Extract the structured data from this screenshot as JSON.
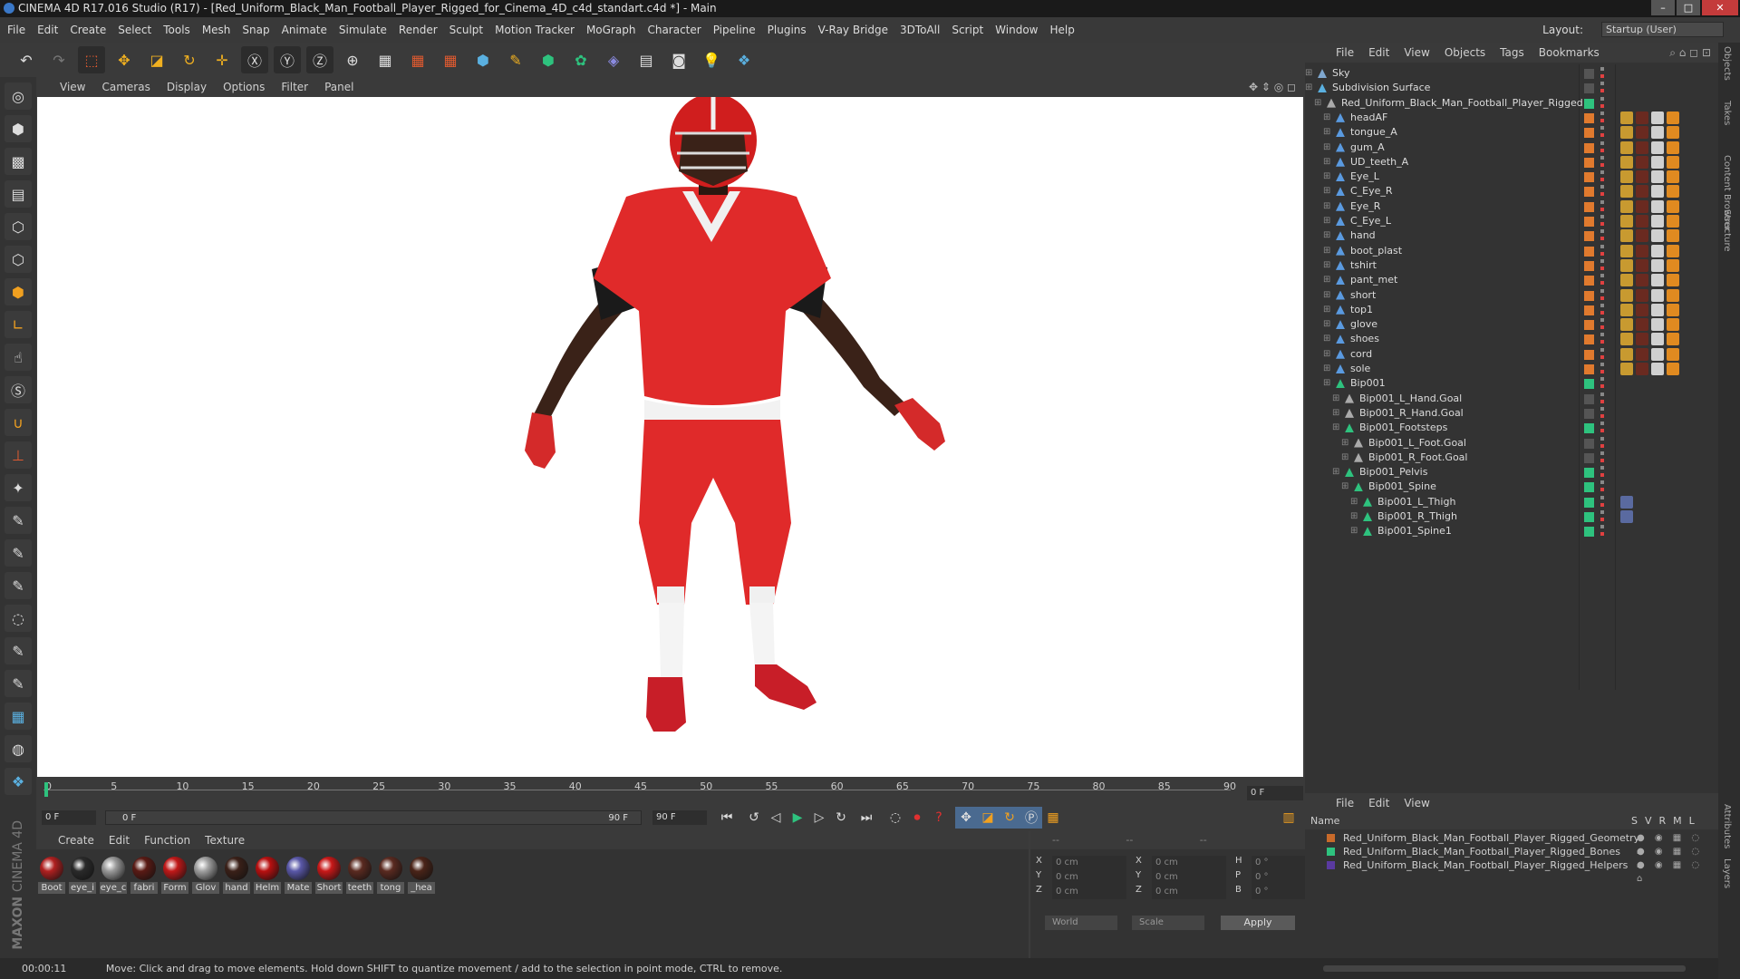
{
  "window": {
    "title": "CINEMA 4D R17.016 Studio (R17) - [Red_Uniform_Black_Man_Football_Player_Rigged_for_Cinema_4D_c4d_standart.c4d *] - Main"
  },
  "menu": [
    "File",
    "Edit",
    "Create",
    "Select",
    "Tools",
    "Mesh",
    "Snap",
    "Animate",
    "Simulate",
    "Render",
    "Sculpt",
    "Motion Tracker",
    "MoGraph",
    "Character",
    "Pipeline",
    "Plugins",
    "V-Ray Bridge",
    "3DToAll",
    "Script",
    "Window",
    "Help"
  ],
  "layout": {
    "label": "Layout:",
    "value": "Startup (User)"
  },
  "viewport_menu": [
    "View",
    "Cameras",
    "Display",
    "Options",
    "Filter",
    "Panel"
  ],
  "timeline": {
    "ticks": [
      "0",
      "5",
      "10",
      "15",
      "20",
      "25",
      "30",
      "35",
      "40",
      "45",
      "50",
      "55",
      "60",
      "65",
      "70",
      "75",
      "80",
      "85",
      "90"
    ],
    "current": "0 F"
  },
  "playbar": {
    "start": "0 F",
    "slider_start": "0 F",
    "slider_end": "90 F",
    "end": "90 F"
  },
  "material_menu": [
    "Create",
    "Edit",
    "Function",
    "Texture"
  ],
  "materials": [
    {
      "name": "Boot",
      "color": "#b02020"
    },
    {
      "name": "eye_i",
      "color": "#2a2a2a"
    },
    {
      "name": "eye_c",
      "color": "#9a9a9a"
    },
    {
      "name": "fabri",
      "color": "#5a1a14"
    },
    {
      "name": "Form",
      "color": "#c01818"
    },
    {
      "name": "Glov",
      "color": "#a0a0a0"
    },
    {
      "name": "hand",
      "color": "#3a2018"
    },
    {
      "name": "Helm",
      "color": "#b81010"
    },
    {
      "name": "Mate",
      "color": "#5a58a8"
    },
    {
      "name": "Short",
      "color": "#c81818"
    },
    {
      "name": "teeth",
      "color": "#5a2a20"
    },
    {
      "name": "tong",
      "color": "#5a2a20"
    },
    {
      "name": "_hea",
      "color": "#4a2418"
    }
  ],
  "coords": {
    "rows": [
      {
        "a": "X",
        "av": "0 cm",
        "b": "X",
        "bv": "0 cm",
        "c": "H",
        "cv": "0 °"
      },
      {
        "a": "Y",
        "av": "0 cm",
        "b": "Y",
        "bv": "0 cm",
        "c": "P",
        "cv": "0 °"
      },
      {
        "a": "Z",
        "av": "0 cm",
        "b": "Z",
        "bv": "0 cm",
        "c": "B",
        "cv": "0 °"
      }
    ],
    "world": "World",
    "scale": "Scale",
    "apply": "Apply"
  },
  "status": {
    "time": "00:00:11",
    "text": "Move: Click and drag to move elements. Hold down SHIFT to quantize movement / add to the selection in point mode, CTRL to remove."
  },
  "object_menu": [
    "File",
    "Edit",
    "View",
    "Objects",
    "Tags",
    "Bookmarks"
  ],
  "objects": [
    {
      "name": "Sky",
      "indent": 0,
      "icon": "#7fa8d0",
      "sq": "#555",
      "tags": 0
    },
    {
      "name": "Subdivision Surface",
      "indent": 0,
      "icon": "#5ab0e0",
      "sq": "#555",
      "tags": 0
    },
    {
      "name": "Red_Uniform_Black_Man_Football_Player_Rigged",
      "indent": 1,
      "icon": "#aaa",
      "sq": "#2ec27e",
      "tags": 0
    },
    {
      "name": "headAF",
      "indent": 2,
      "icon": "#5a9ae0",
      "sq": "#e07a2e",
      "tags": 1
    },
    {
      "name": "tongue_A",
      "indent": 2,
      "icon": "#5a9ae0",
      "sq": "#e07a2e",
      "tags": 1
    },
    {
      "name": "gum_A",
      "indent": 2,
      "icon": "#5a9ae0",
      "sq": "#e07a2e",
      "tags": 1
    },
    {
      "name": "UD_teeth_A",
      "indent": 2,
      "icon": "#5a9ae0",
      "sq": "#e07a2e",
      "tags": 1
    },
    {
      "name": "Eye_L",
      "indent": 2,
      "icon": "#5a9ae0",
      "sq": "#e07a2e",
      "tags": 1
    },
    {
      "name": "C_Eye_R",
      "indent": 2,
      "icon": "#5a9ae0",
      "sq": "#e07a2e",
      "tags": 1
    },
    {
      "name": "Eye_R",
      "indent": 2,
      "icon": "#5a9ae0",
      "sq": "#e07a2e",
      "tags": 1
    },
    {
      "name": "C_Eye_L",
      "indent": 2,
      "icon": "#5a9ae0",
      "sq": "#e07a2e",
      "tags": 1
    },
    {
      "name": "hand",
      "indent": 2,
      "icon": "#5a9ae0",
      "sq": "#e07a2e",
      "tags": 1
    },
    {
      "name": "boot_plast",
      "indent": 2,
      "icon": "#5a9ae0",
      "sq": "#e07a2e",
      "tags": 1
    },
    {
      "name": "tshirt",
      "indent": 2,
      "icon": "#5a9ae0",
      "sq": "#e07a2e",
      "tags": 1
    },
    {
      "name": "pant_met",
      "indent": 2,
      "icon": "#5a9ae0",
      "sq": "#e07a2e",
      "tags": 1
    },
    {
      "name": "short",
      "indent": 2,
      "icon": "#5a9ae0",
      "sq": "#e07a2e",
      "tags": 1
    },
    {
      "name": "top1",
      "indent": 2,
      "icon": "#5a9ae0",
      "sq": "#e07a2e",
      "tags": 1
    },
    {
      "name": "glove",
      "indent": 2,
      "icon": "#5a9ae0",
      "sq": "#e07a2e",
      "tags": 1
    },
    {
      "name": "shoes",
      "indent": 2,
      "icon": "#5a9ae0",
      "sq": "#e07a2e",
      "tags": 1
    },
    {
      "name": "cord",
      "indent": 2,
      "icon": "#5a9ae0",
      "sq": "#e07a2e",
      "tags": 1
    },
    {
      "name": "sole",
      "indent": 2,
      "icon": "#5a9ae0",
      "sq": "#e07a2e",
      "tags": 1
    },
    {
      "name": "Bip001",
      "indent": 2,
      "icon": "#2ec27e",
      "sq": "#2ec27e",
      "tags": 0
    },
    {
      "name": "Bip001_L_Hand.Goal",
      "indent": 3,
      "icon": "#aaa",
      "sq": "#555",
      "tags": 0
    },
    {
      "name": "Bip001_R_Hand.Goal",
      "indent": 3,
      "icon": "#aaa",
      "sq": "#555",
      "tags": 0
    },
    {
      "name": "Bip001_Footsteps",
      "indent": 3,
      "icon": "#2ec27e",
      "sq": "#2ec27e",
      "tags": 0
    },
    {
      "name": "Bip001_L_Foot.Goal",
      "indent": 4,
      "icon": "#aaa",
      "sq": "#555",
      "tags": 0
    },
    {
      "name": "Bip001_R_Foot.Goal",
      "indent": 4,
      "icon": "#aaa",
      "sq": "#555",
      "tags": 0
    },
    {
      "name": "Bip001_Pelvis",
      "indent": 3,
      "icon": "#2ec27e",
      "sq": "#2ec27e",
      "tags": 0
    },
    {
      "name": "Bip001_Spine",
      "indent": 4,
      "icon": "#2ec27e",
      "sq": "#2ec27e",
      "tags": 0
    },
    {
      "name": "Bip001_L_Thigh",
      "indent": 5,
      "icon": "#2ec27e",
      "sq": "#2ec27e",
      "tags": 2
    },
    {
      "name": "Bip001_R_Thigh",
      "indent": 5,
      "icon": "#2ec27e",
      "sq": "#2ec27e",
      "tags": 2
    },
    {
      "name": "Bip001_Spine1",
      "indent": 5,
      "icon": "#2ec27e",
      "sq": "#2ec27e",
      "tags": 0
    }
  ],
  "layer_menu": [
    "File",
    "Edit",
    "View"
  ],
  "layer_cols": {
    "name": "Name",
    "cols": [
      "S",
      "V",
      "R",
      "M",
      "L"
    ]
  },
  "layers": [
    {
      "name": "Red_Uniform_Black_Man_Football_Player_Rigged_Geometry",
      "color": "#c86a2a"
    },
    {
      "name": "Red_Uniform_Black_Man_Football_Player_Rigged_Bones",
      "color": "#2ec27e"
    },
    {
      "name": "Red_Uniform_Black_Man_Football_Player_Rigged_Helpers",
      "color": "#5a3aa0"
    }
  ],
  "side_tabs": [
    "Objects",
    "Takes",
    "Content Browser",
    "Structure"
  ],
  "side_tabs2": [
    "Attributes",
    "Layers"
  ],
  "brand": {
    "line1": "MAXON",
    "line2": "CINEMA 4D"
  }
}
